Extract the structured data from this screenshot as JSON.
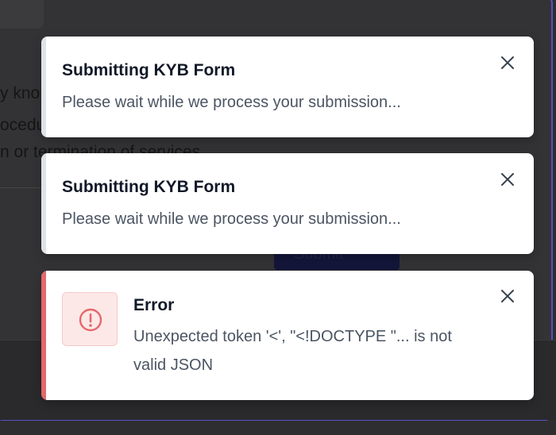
{
  "background": {
    "text_lines": [
      "y kno",
      "ocedu",
      "n or termination of services"
    ],
    "submit_label": "Submit"
  },
  "toasts": [
    {
      "title": "Submitting KYB Form",
      "message": "Please wait while we process your submission...",
      "variant": "loading"
    },
    {
      "title": "Submitting KYB Form",
      "message": "Please wait while we process your submission...",
      "variant": "loading"
    },
    {
      "title": "Error",
      "message": "Unexpected token '<', \"<!DOCTYPE \"... is not valid JSON",
      "variant": "error",
      "icon": "alert-circle-icon"
    }
  ],
  "colors": {
    "error": "#e5686a",
    "accent": "#5b4fc7"
  }
}
